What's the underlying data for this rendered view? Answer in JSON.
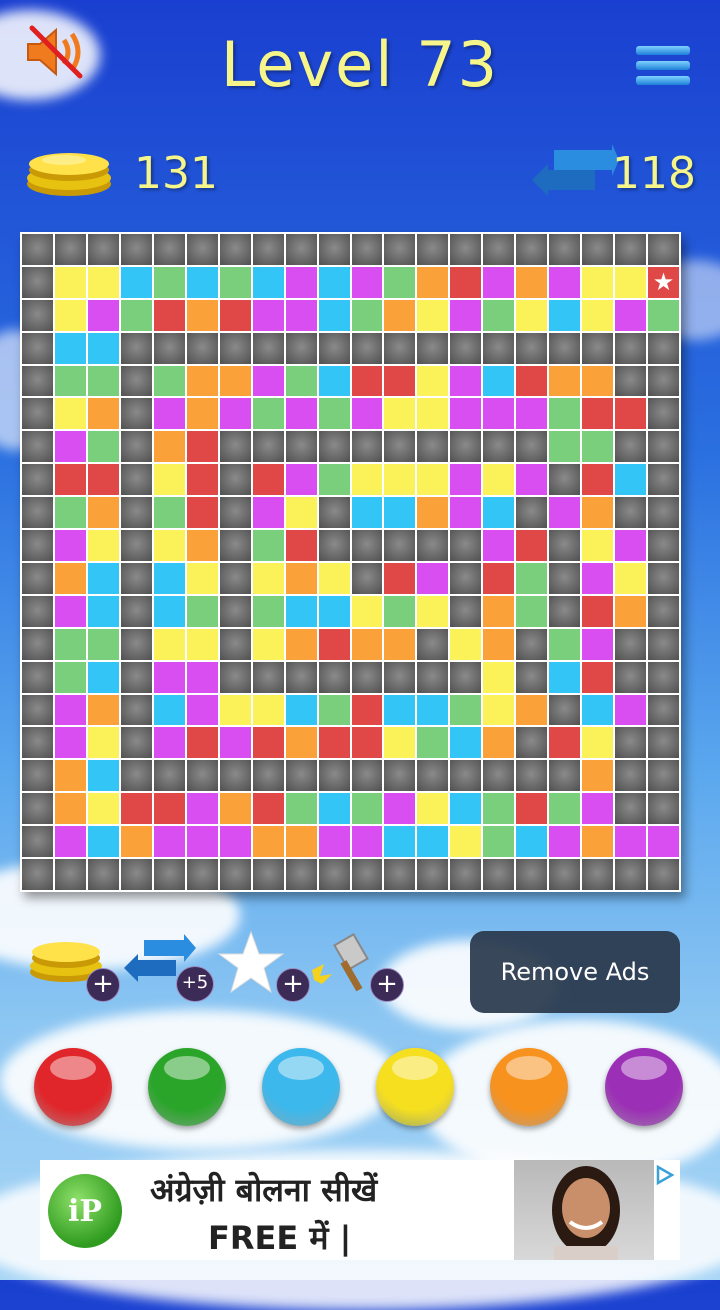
{
  "header": {
    "level_title": "Level 73",
    "sound_icon": "speaker-muted-icon",
    "menu_icon": "hamburger-menu-icon"
  },
  "stats": {
    "coins": "131",
    "coins_icon": "gold-coins-icon",
    "moves": "118",
    "moves_icon": "swap-arrows-icon"
  },
  "board": {
    "size": 20,
    "legend": {
      "k": "gray-empty",
      "y": "yellow",
      "g": "green",
      "b": "blue",
      "p": "purple",
      "o": "orange",
      "r": "red",
      "s": "star"
    },
    "rows": [
      "kkkkkkkkkkkkkkkkkkkk",
      "kyybgbgbpbpgorpopyys",
      "kypgrorppbgoypgybypg",
      "kbbkkkkkkkkkkkkkkkkk",
      "kggkgoopgbrrypbrook",
      "kyokpopgpgpyypppgrrk",
      "kpgkorkkkkkkkkkkggkk",
      "krrkyrkrpgyyypypkrbk",
      "kgokgrkpykbbopbkpok",
      "kpykyokgrkkkkkprkypk",
      "kobkbykyoykrpkrgkpyk",
      "kpbkbgkgbbygykogkro",
      "kggkyykyorookyokgpk",
      "kgbkppkkkkkkkkykbrk",
      "kpokbpyybgrbbgyokbpk",
      "kpykprprorrygbokryk",
      "kobkkkkkkkkkkkkkkokk",
      "koyrrporgbgpybgrgpk",
      "kpbopppooppbbygbpoppk",
      "kkkkkkkkkkkkkkkkkkkkk"
    ]
  },
  "powerups": [
    {
      "name": "add-coins",
      "icon": "gold-coins-icon",
      "badge": "+"
    },
    {
      "name": "add-moves",
      "icon": "swap-arrows-icon",
      "badge": "+5"
    },
    {
      "name": "add-star",
      "icon": "star-icon",
      "badge": "+"
    },
    {
      "name": "add-hammer",
      "icon": "hammer-icon",
      "badge": "+"
    }
  ],
  "remove_ads_label": "Remove Ads",
  "color_buttons": [
    {
      "name": "red",
      "color": "#e0262a"
    },
    {
      "name": "green",
      "color": "#2aa52a"
    },
    {
      "name": "blue",
      "color": "#3cb8ec"
    },
    {
      "name": "yellow",
      "color": "#f6df1e"
    },
    {
      "name": "orange",
      "color": "#f7921e"
    },
    {
      "name": "purple",
      "color": "#9b2fb5"
    }
  ],
  "ad": {
    "logo_text": "iP",
    "line1": "अंग्रेज़ी बोलना सीखें",
    "line2": "FREE में |",
    "adchoices_icon": "adchoices-icon"
  }
}
